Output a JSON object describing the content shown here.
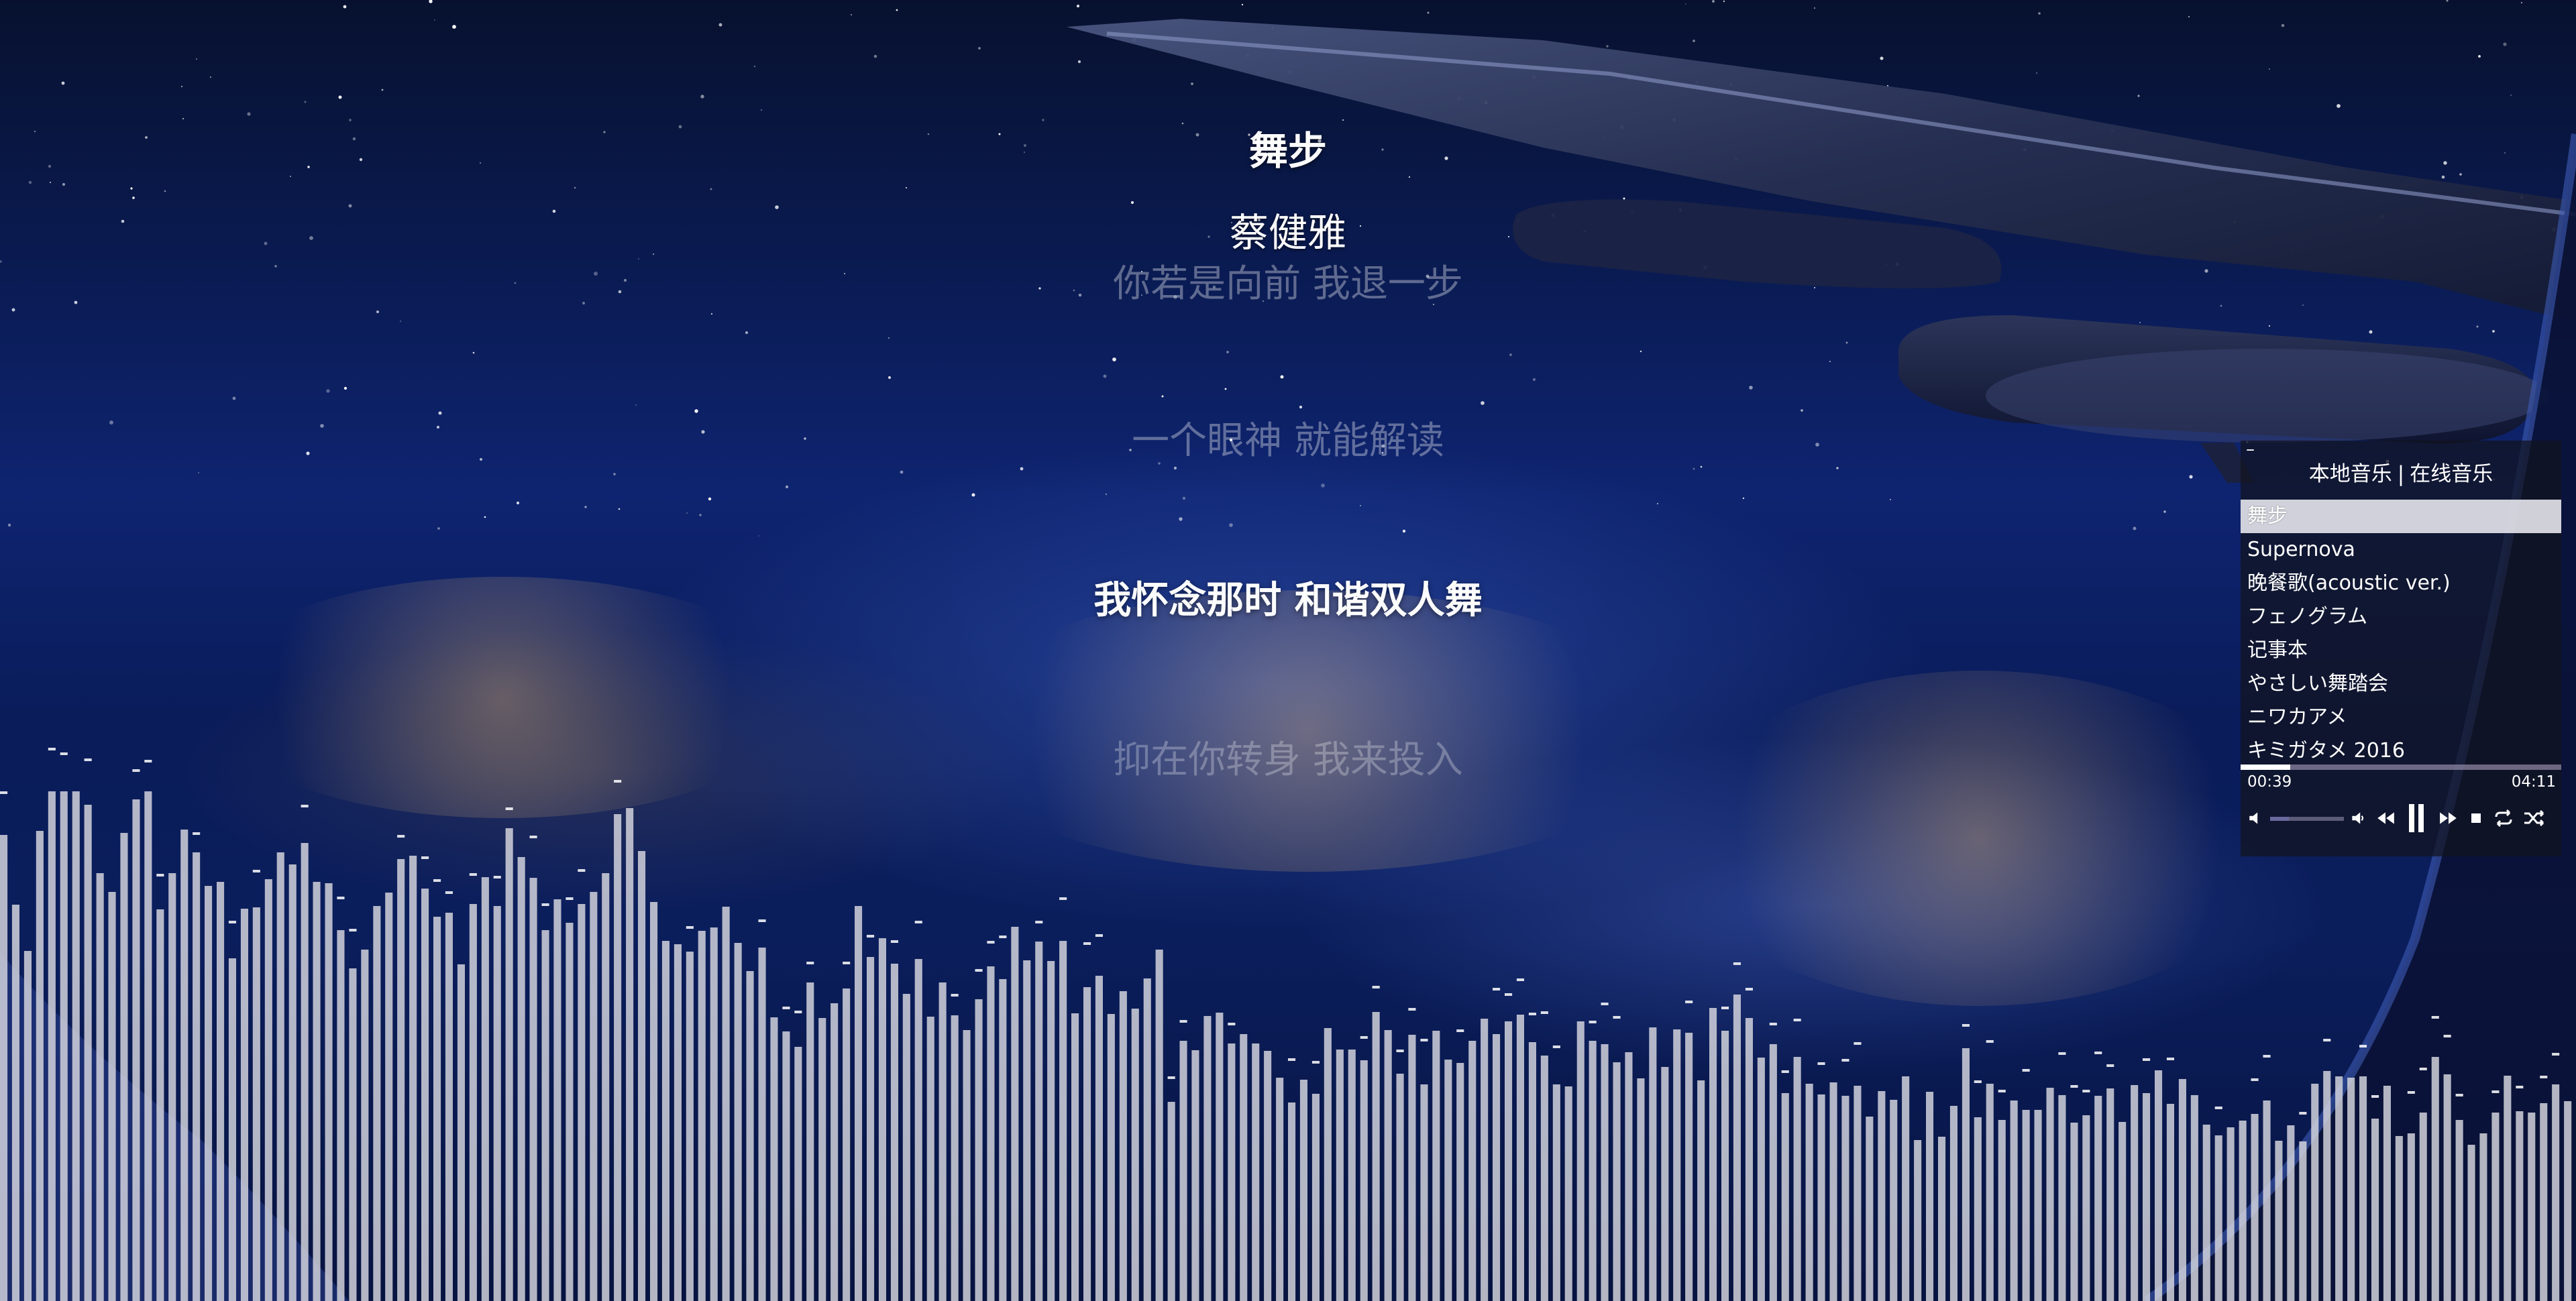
{
  "song": {
    "title": "舞步",
    "artist": "蔡健雅"
  },
  "lyrics": [
    "你若是向前 我退一步",
    "一个眼神 就能解读",
    "我怀念那时 和谐双人舞",
    "抑在你转身 我来投入"
  ],
  "player": {
    "tabs": {
      "local": "本地音乐",
      "separator": "|",
      "online": "在线音乐"
    },
    "minimize_label": "–",
    "playlist": [
      "舞步",
      "Supernova",
      "晚餐歌(acoustic ver.)",
      "フェノグラム",
      "记事本",
      "やさしい舞踏会",
      "ニワカアメ",
      "キミガタメ 2016"
    ],
    "active_index": 0,
    "time_current": "00:39",
    "time_total": "04:11",
    "progress": 0.155,
    "volume": 0.25,
    "icons": {
      "volume": "volume-icon",
      "volume_down": "volume-down-icon",
      "previous": "previous-icon",
      "pause": "pause-icon",
      "next": "next-icon",
      "stop": "stop-icon",
      "repeat": "repeat-icon",
      "shuffle": "shuffle-icon"
    }
  },
  "colors": {
    "sky_top": "#07112f",
    "sky_mid": "#0e2470",
    "bar_fill": "#d9d9e0",
    "panel_bg": "rgba(18,20,30,0.72)"
  }
}
